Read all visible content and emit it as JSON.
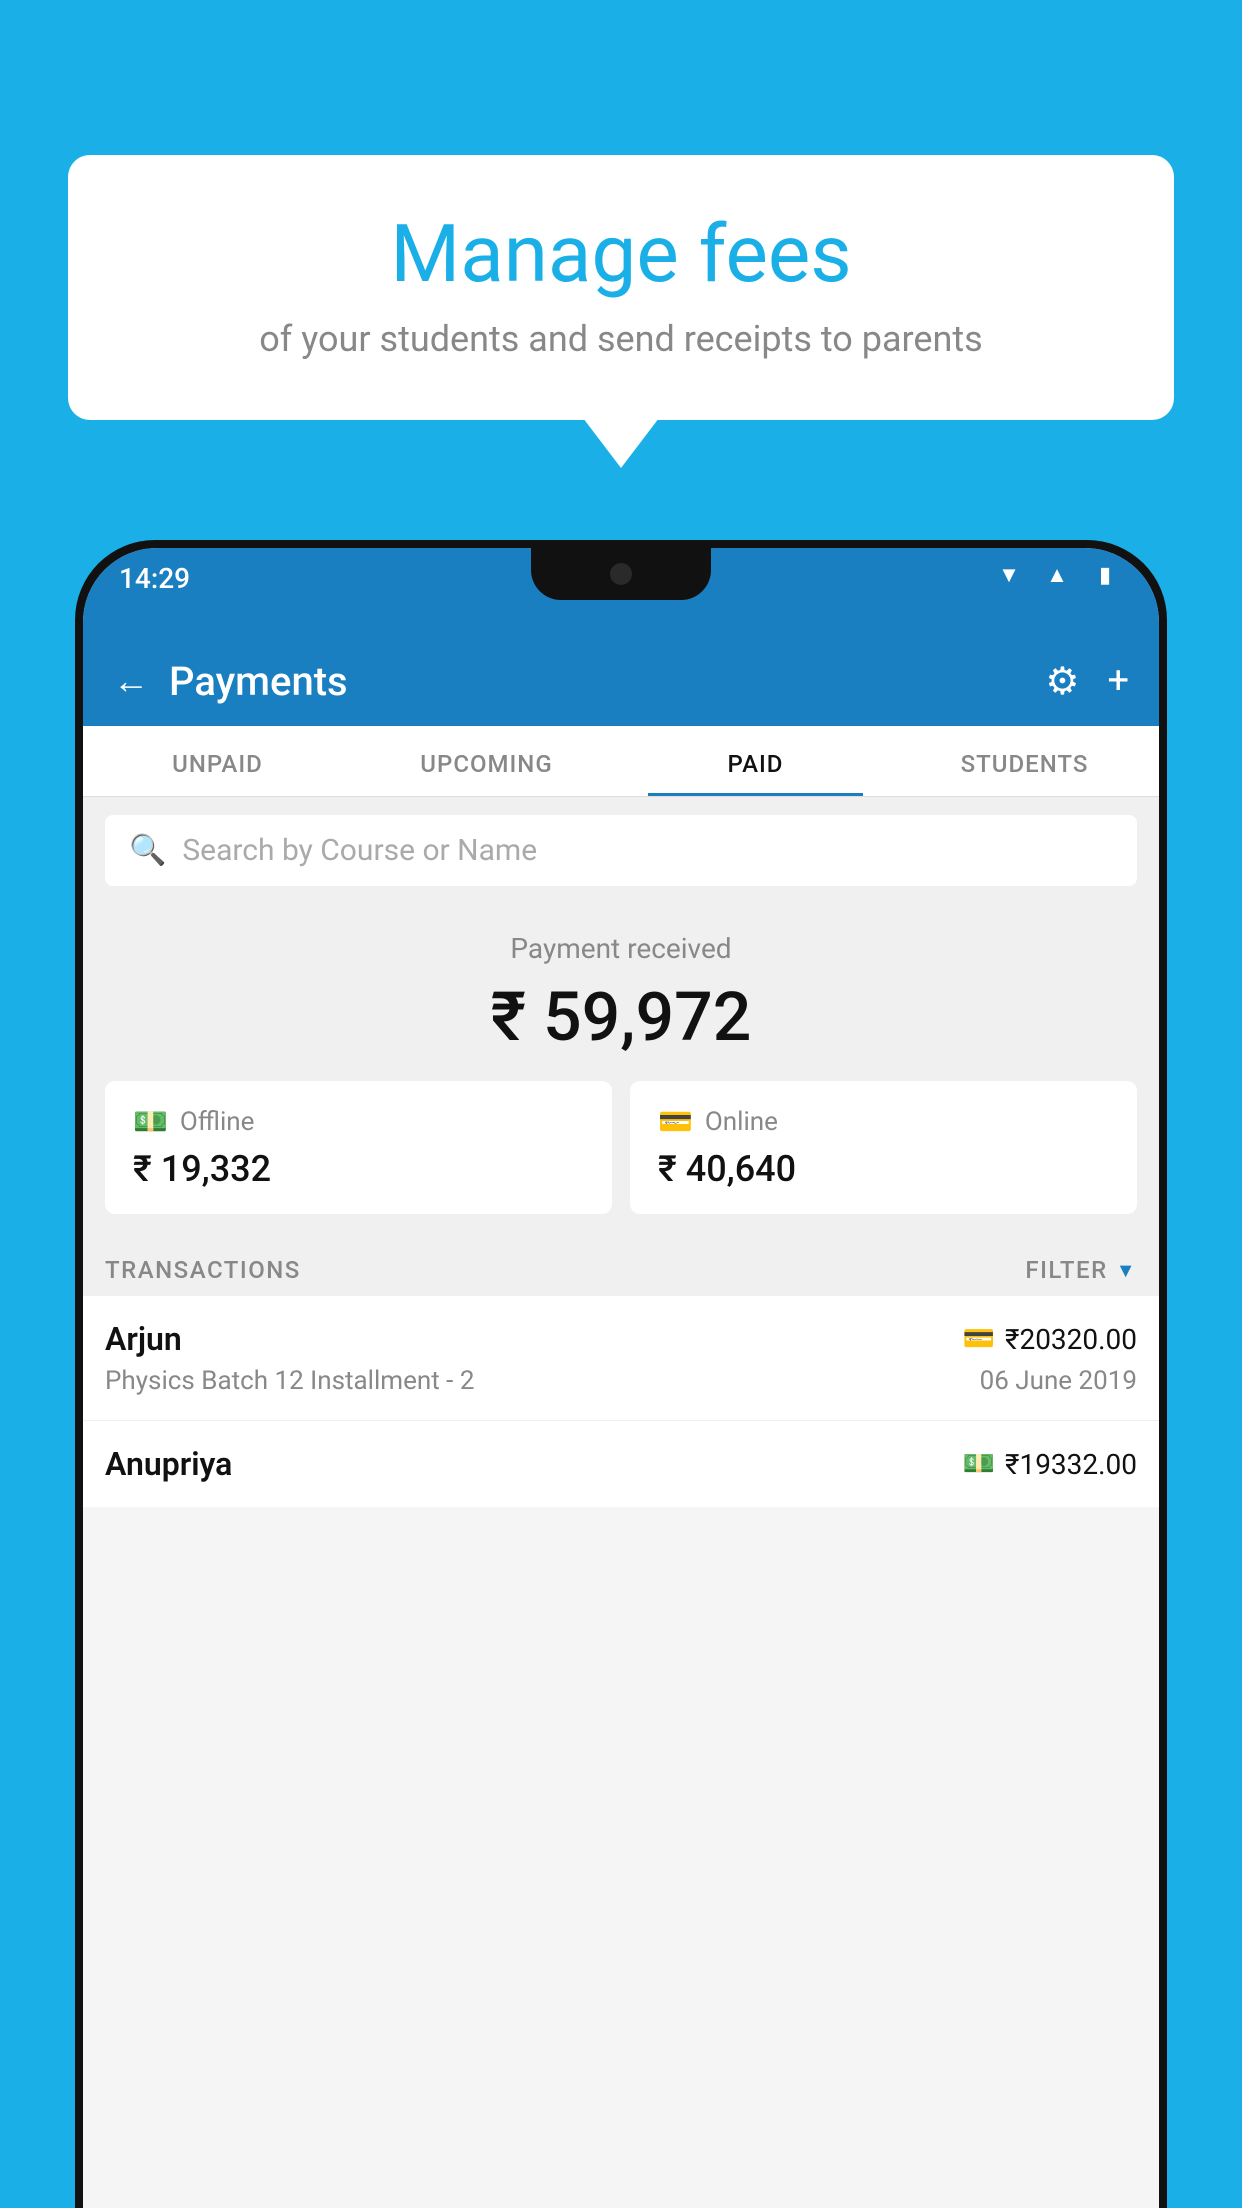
{
  "page": {
    "background_color": "#1AAFE6"
  },
  "bubble": {
    "title": "Manage fees",
    "subtitle": "of your students and send receipts to parents"
  },
  "status_bar": {
    "time": "14:29",
    "icons": [
      "wifi",
      "signal",
      "battery"
    ]
  },
  "header": {
    "title": "Payments",
    "back_label": "←",
    "settings_icon": "gear",
    "add_icon": "+"
  },
  "tabs": [
    {
      "label": "UNPAID",
      "active": false
    },
    {
      "label": "UPCOMING",
      "active": false
    },
    {
      "label": "PAID",
      "active": true
    },
    {
      "label": "STUDENTS",
      "active": false
    }
  ],
  "search": {
    "placeholder": "Search by Course or Name"
  },
  "payment_summary": {
    "label": "Payment received",
    "amount": "₹ 59,972",
    "offline": {
      "type": "Offline",
      "amount": "₹ 19,332",
      "icon": "rupee-note"
    },
    "online": {
      "type": "Online",
      "amount": "₹ 40,640",
      "icon": "card"
    }
  },
  "transactions": {
    "header": "TRANSACTIONS",
    "filter_label": "FILTER",
    "items": [
      {
        "name": "Arjun",
        "course": "Physics Batch 12 Installment - 2",
        "amount": "₹20320.00",
        "date": "06 June 2019",
        "payment_type": "online"
      },
      {
        "name": "Anupriya",
        "course": "",
        "amount": "₹19332.00",
        "date": "",
        "payment_type": "offline"
      }
    ]
  }
}
